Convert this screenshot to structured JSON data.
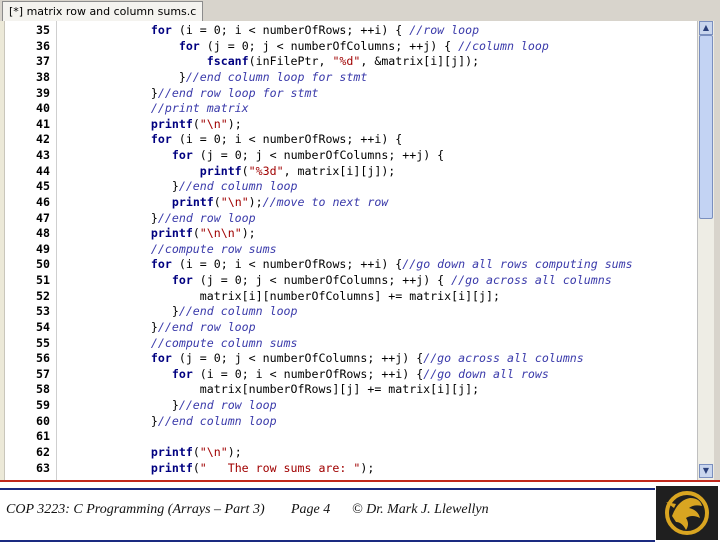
{
  "window": {
    "tab_title": "[*] matrix row and column sums.c"
  },
  "editor": {
    "lines": [
      {
        "n": "35",
        "code": "    for (i = 0; i < numberOfRows; ++i) { //row loop"
      },
      {
        "n": "36",
        "code": "        for (j = 0; j < numberOfColumns; ++j) { //column loop"
      },
      {
        "n": "37",
        "code": "            fscanf(inFilePtr, \"%d\", &matrix[i][j]);"
      },
      {
        "n": "38",
        "code": "        }//end column loop for stmt"
      },
      {
        "n": "39",
        "code": "    }//end row loop for stmt"
      },
      {
        "n": "40",
        "code": "    //print matrix"
      },
      {
        "n": "41",
        "code": "    printf(\"\\n\");"
      },
      {
        "n": "42",
        "code": "    for (i = 0; i < numberOfRows; ++i) {"
      },
      {
        "n": "43",
        "code": "       for (j = 0; j < numberOfColumns; ++j) {"
      },
      {
        "n": "44",
        "code": "           printf(\"%3d\", matrix[i][j]);"
      },
      {
        "n": "45",
        "code": "       }//end column loop"
      },
      {
        "n": "46",
        "code": "       printf(\"\\n\");//move to next row"
      },
      {
        "n": "47",
        "code": "    }//end row loop"
      },
      {
        "n": "48",
        "code": "    printf(\"\\n\\n\");"
      },
      {
        "n": "49",
        "code": "    //compute row sums"
      },
      {
        "n": "50",
        "code": "    for (i = 0; i < numberOfRows; ++i) {//go down all rows computing sums"
      },
      {
        "n": "51",
        "code": "       for (j = 0; j < numberOfColumns; ++j) { //go across all columns"
      },
      {
        "n": "52",
        "code": "           matrix[i][numberOfColumns] += matrix[i][j];"
      },
      {
        "n": "53",
        "code": "       }//end column loop"
      },
      {
        "n": "54",
        "code": "    }//end row loop"
      },
      {
        "n": "55",
        "code": "    //compute column sums"
      },
      {
        "n": "56",
        "code": "    for (j = 0; j < numberOfColumns; ++j) {//go across all columns"
      },
      {
        "n": "57",
        "code": "       for (i = 0; i < numberOfRows; ++i) {//go down all rows"
      },
      {
        "n": "58",
        "code": "           matrix[numberOfRows][j] += matrix[i][j];"
      },
      {
        "n": "59",
        "code": "       }//end row loop"
      },
      {
        "n": "60",
        "code": "    }//end column loop"
      },
      {
        "n": "61",
        "code": ""
      },
      {
        "n": "62",
        "code": "    printf(\"\\n\");"
      },
      {
        "n": "63",
        "code": "    printf(\"   The row sums are: \");"
      }
    ]
  },
  "scrollbar": {
    "up_glyph": "▲",
    "down_glyph": "▼",
    "position_fraction": 0.43
  },
  "footer": {
    "course": "COP 3223: C Programming (Arrays – Part 3)",
    "page": "Page 4",
    "copyright": "© Dr. Mark J. Llewellyn"
  },
  "colors": {
    "accent_line": "#c0281c",
    "footer_rule": "#1a2a80",
    "keyword": "#000080",
    "comment": "#3a3aaa",
    "string": "#a00000",
    "logo_gold": "#d9a521"
  },
  "icons": {
    "logo": "ucf-pegasus-logo",
    "scroll_up": "scroll-up-arrow-icon",
    "scroll_down": "scroll-down-arrow-icon"
  }
}
